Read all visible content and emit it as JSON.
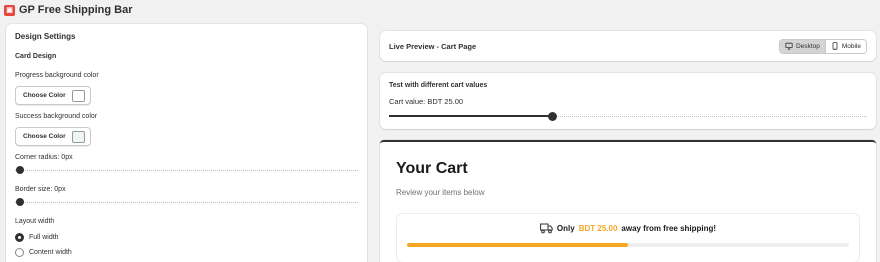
{
  "app": {
    "title": "GP Free Shipping Bar",
    "logo_icon": "app-logo-icon"
  },
  "settings": {
    "title": "Design Settings",
    "card_design": "Card Design",
    "progress_bg": {
      "label": "Progress background color",
      "button": "Choose Color",
      "swatch": "#ffffff"
    },
    "success_bg": {
      "label": "Success background color",
      "button": "Choose Color",
      "swatch": "#eef7f2"
    },
    "corner_radius": {
      "label": "Corner radius: 0px",
      "value": 0
    },
    "border_size": {
      "label": "Border size: 0px",
      "value": 0
    },
    "layout_width": {
      "label": "Layout width",
      "options": [
        {
          "label": "Full width",
          "checked": true
        },
        {
          "label": "Content width",
          "checked": false
        }
      ]
    }
  },
  "preview": {
    "title": "Live Preview - Cart Page",
    "toggle": {
      "desktop": "Desktop",
      "mobile": "Mobile",
      "active": "desktop"
    }
  },
  "test": {
    "title": "Test with different cart values",
    "label": "Cart value: BDT 25.00",
    "fraction": 0.34
  },
  "cart": {
    "title": "Your Cart",
    "subtitle": "Review your items below",
    "msg_prefix": "Only",
    "msg_amount": "BDT 25.00",
    "msg_suffix": "away from free shipping!",
    "progress": 0.5,
    "accent": "#f5a623"
  }
}
